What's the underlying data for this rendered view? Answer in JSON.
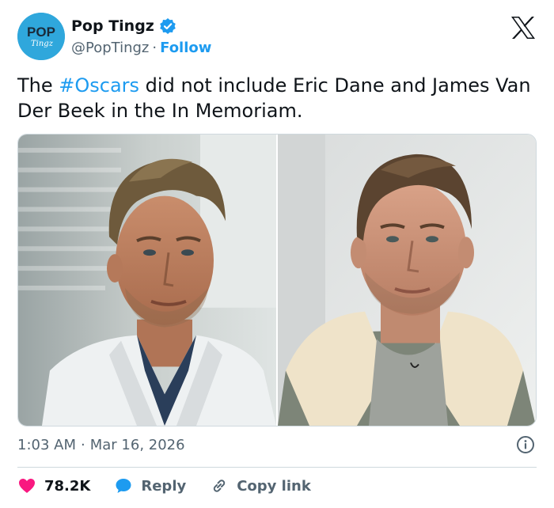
{
  "author": {
    "display_name": "Pop Tingz",
    "handle": "@PopTingz",
    "follow_label": "Follow",
    "avatar_text_top": "POP",
    "avatar_text_bottom": "Tingz",
    "brand_color": "#2fa7dc",
    "verified_color": "#1d9bf0"
  },
  "tweet": {
    "text_prefix": "The ",
    "hashtag": "#Oscars",
    "text_suffix": "  did not include Eric Dane and James Van Der Beek in the In Memoriam."
  },
  "meta": {
    "time": "1:03 AM",
    "separator": "·",
    "date": "Mar 16, 2026"
  },
  "actions": {
    "likes": "78.2K",
    "reply_label": "Reply",
    "copy_label": "Copy link"
  },
  "icons": {
    "platform": "x-logo-icon",
    "verified": "verified-badge-icon",
    "info": "info-icon",
    "like": "heart-icon",
    "reply": "speech-bubble-icon",
    "link": "link-icon"
  },
  "colors": {
    "accent": "#1d9bf0",
    "like": "#f91880",
    "muted": "#536471",
    "text": "#0f1419"
  }
}
